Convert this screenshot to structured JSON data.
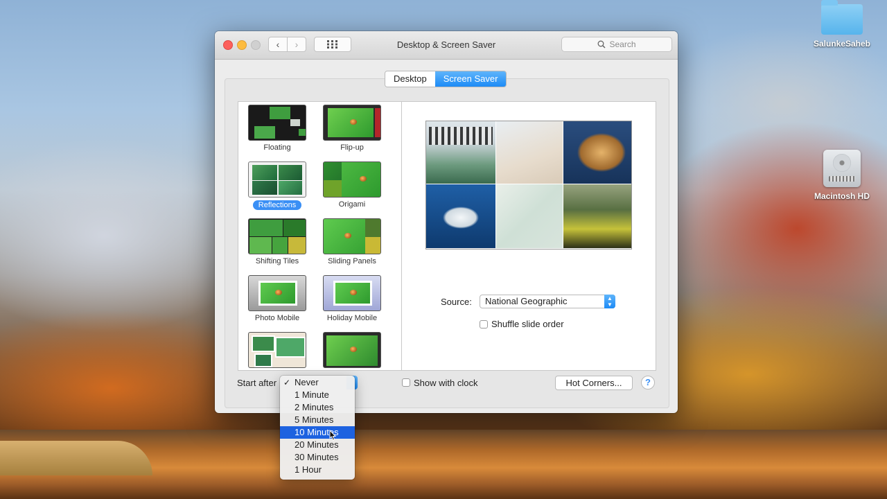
{
  "window": {
    "title": "Desktop & Screen Saver",
    "search_placeholder": "Search",
    "back_label": "‹",
    "forward_label": "›",
    "grid_label": "⋮⋮⋮"
  },
  "tabs": [
    {
      "label": "Desktop",
      "selected": false
    },
    {
      "label": "Screen Saver",
      "selected": true
    }
  ],
  "screen_savers": [
    {
      "label": "Floating"
    },
    {
      "label": "Flip-up"
    },
    {
      "label": "Reflections",
      "selected": true
    },
    {
      "label": "Origami"
    },
    {
      "label": "Shifting Tiles"
    },
    {
      "label": "Sliding Panels"
    },
    {
      "label": "Photo Mobile"
    },
    {
      "label": "Holiday Mobile"
    }
  ],
  "preview": {
    "source_label": "Source:",
    "source_value": "National Geographic",
    "shuffle_label": "Shuffle slide order",
    "shuffle_checked": false
  },
  "bottom": {
    "start_after_label": "Start after",
    "show_clock_label": "Show with clock",
    "show_clock_checked": false,
    "hot_corners_label": "Hot Corners...",
    "help_label": "?"
  },
  "start_after_menu": {
    "items": [
      "Never",
      "1 Minute",
      "2 Minutes",
      "5 Minutes",
      "10 Minutes",
      "20 Minutes",
      "30 Minutes",
      "1 Hour"
    ],
    "checked": "Never",
    "highlighted": "10 Minutes"
  },
  "desktop_icons": [
    {
      "label": "SalunkeSaheb",
      "icon": "folder-icon"
    },
    {
      "label": "Macintosh HD",
      "icon": "hard-drive-icon"
    }
  ],
  "colors": {
    "accent": "#1d8bf6",
    "menu_highlight": "#1d62e0",
    "close": "#fc605c",
    "minimize": "#fdbc40"
  }
}
